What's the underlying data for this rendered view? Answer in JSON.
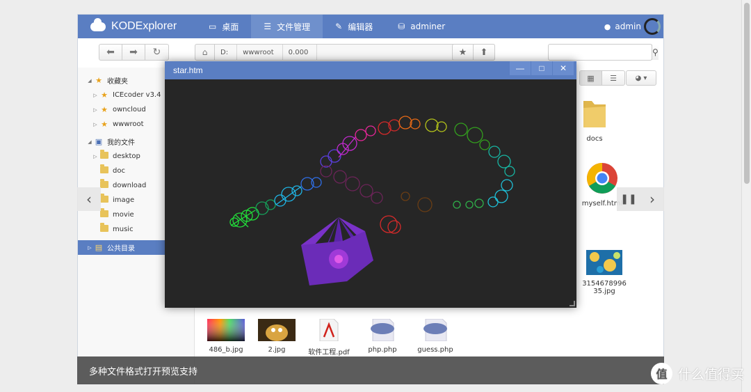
{
  "header": {
    "app_title": "KODExplorer",
    "nav": [
      {
        "label": "桌面",
        "icon": "monitor-icon"
      },
      {
        "label": "文件管理",
        "icon": "server-icon"
      },
      {
        "label": "编辑器",
        "icon": "edit-icon"
      },
      {
        "label": "adminer",
        "icon": "drive-icon"
      }
    ],
    "user": "admin"
  },
  "toolbar": {
    "breadcrumb": [
      "D:",
      "wwwroot",
      "0.000"
    ],
    "search_placeholder": ""
  },
  "sidebar": {
    "favorites_label": "收藏夹",
    "favorites": [
      "ICEcoder v3.4",
      "owncloud",
      "wwwroot"
    ],
    "myfiles_label": "我的文件",
    "myfiles": [
      "desktop",
      "doc",
      "download",
      "image",
      "movie",
      "music"
    ],
    "public_label": "公共目录"
  },
  "files": {
    "docs": "docs",
    "myself": "myself.html",
    "jpg_name_line1": "3154678996",
    "jpg_name_line2": "35.jpg",
    "bottom": [
      "486_b.jpg",
      "2.jpg",
      "软件工程.pdf",
      "php.php",
      "guess.php"
    ]
  },
  "window": {
    "title": "star.htm"
  },
  "caption": "多种文件格式打开预览支持",
  "watermark": {
    "badge": "值",
    "text": "什么值得买"
  },
  "colors": {
    "brand": "#5a7ec2",
    "nav_active": "#6f90cc",
    "window_bg": "#262626"
  }
}
